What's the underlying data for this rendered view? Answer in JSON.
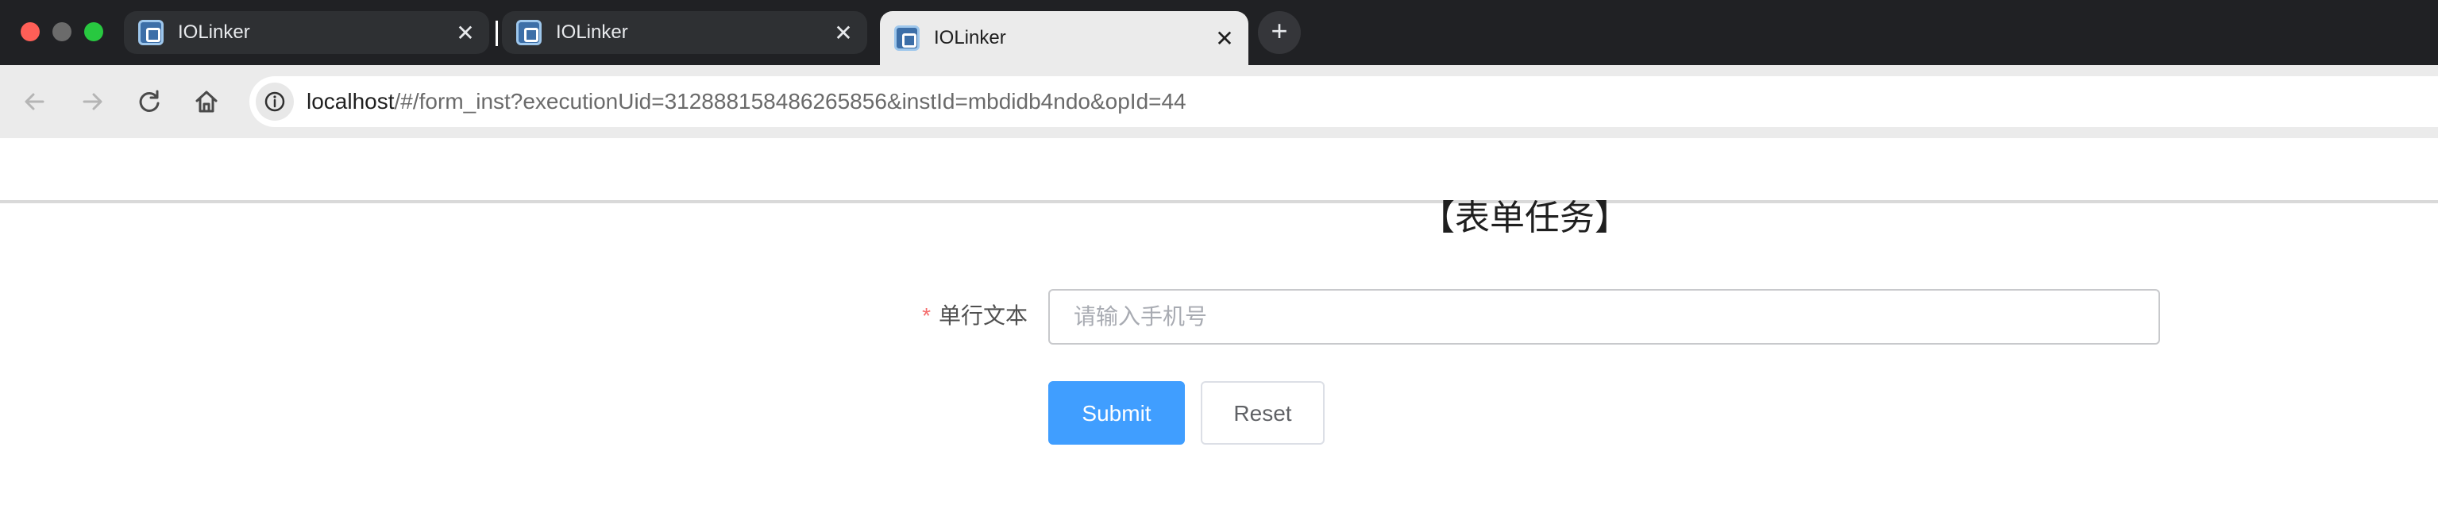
{
  "browser": {
    "tabs": [
      {
        "title": "IOLinker",
        "close": "✕",
        "active": false
      },
      {
        "title": "IOLinker",
        "close": "✕",
        "active": false
      },
      {
        "title": "IOLinker",
        "close": "✕",
        "active": true
      }
    ],
    "new_tab": "+",
    "url": {
      "host": "localhost",
      "path": "/#/form_inst?executionUid=312888158486265856&instId=mbdidb4ndo&opId=44"
    },
    "icons": {
      "back": "arrow-left-icon",
      "forward": "arrow-right-icon",
      "reload": "reload-icon",
      "home": "home-icon",
      "site_info": "info-icon",
      "favicon": "iolinker-favicon-icon",
      "close": "close-icon"
    }
  },
  "form": {
    "title": "【表单任务】",
    "field": {
      "required_mark": "*",
      "label": "单行文本",
      "placeholder": "请输入手机号",
      "value": ""
    },
    "buttons": {
      "submit": "Submit",
      "reset": "Reset"
    }
  },
  "colors": {
    "primary": "#409eff",
    "required": "#f56c6c",
    "tabstrip": "#202124",
    "toolbar": "#ebebeb"
  }
}
